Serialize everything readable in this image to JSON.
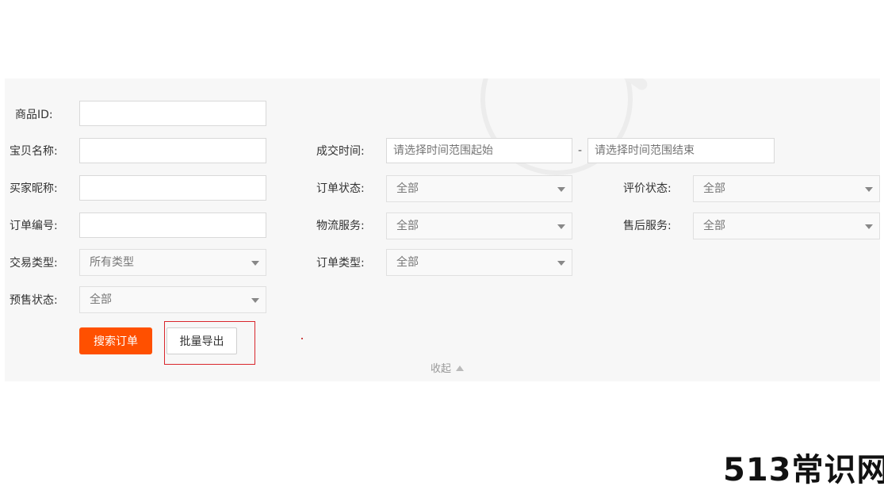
{
  "form": {
    "product_id_label": "商品ID:",
    "item_name_label": "宝贝名称:",
    "buyer_nick_label": "买家昵称:",
    "order_no_label": "订单编号:",
    "trade_type_label": "交易类型:",
    "trade_type_value": "所有类型",
    "presale_label": "预售状态:",
    "presale_value": "全部",
    "deal_time_label": "成交时间:",
    "deal_time_start_placeholder": "请选择时间范围起始",
    "deal_time_separator": "-",
    "deal_time_end_placeholder": "请选择时间范围结束",
    "order_status_label": "订单状态:",
    "order_status_value": "全部",
    "logistics_label": "物流服务:",
    "logistics_value": "全部",
    "order_type_label": "订单类型:",
    "order_type_value": "全部",
    "review_status_label": "评价状态:",
    "review_status_value": "全部",
    "after_sale_label": "售后服务:",
    "after_sale_value": "全部"
  },
  "actions": {
    "search_label": "搜索订单",
    "export_label": "批量导出",
    "collapse_label": "收起"
  },
  "watermark": "513常识网",
  "colors": {
    "accent": "#ff5000",
    "highlight_frame": "#d9262c"
  }
}
